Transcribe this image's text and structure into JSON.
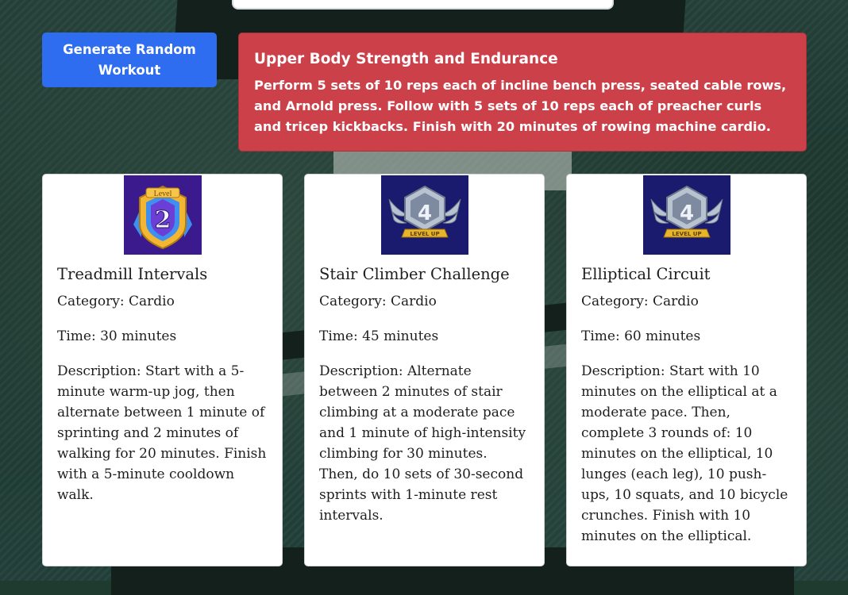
{
  "actions": {
    "generate_button_label": "Generate Random Workout"
  },
  "featured": {
    "title": "Upper Body Strength and Endurance",
    "description": "Perform 5 sets of 10 reps each of incline bench press, seated cable rows, and Arnold press. Follow with 5 sets of 10 reps each of preacher curls and tricep kickbacks. Finish with 20 minutes of rowing machine cardio."
  },
  "cards": [
    {
      "title": "Treadmill Intervals",
      "category": "Category: Cardio",
      "time": "Time: 30 minutes",
      "description": "Description: Start with a 5-minute warm-up jog, then alternate between 1 minute of sprinting and 2 minutes of walking for 20 minutes. Finish with a 5-minute cooldown walk.",
      "badge": {
        "icon": "level-badge-icon",
        "top_text": "Level",
        "number": "2",
        "colors": {
          "bg": "#3a1a8c",
          "gold": "#f2b632",
          "blue": "#3e8ff0"
        }
      }
    },
    {
      "title": "Stair Climber Challenge",
      "category": "Category: Cardio",
      "time": "Time: 45 minutes",
      "description": "Description: Alternate between 2 minutes of stair climbing at a moderate pace and 1 minute of high-intensity climbing for 30 minutes. Then, do 10 sets of 30-second sprints with 1-minute rest intervals.",
      "badge": {
        "icon": "level-up-badge-icon",
        "number": "4",
        "ribbon_text": "LEVEL UP",
        "colors": {
          "bg": "#1a1a6e",
          "silver": "#b8c2d0",
          "gold": "#e8b52a"
        }
      }
    },
    {
      "title": "Elliptical Circuit",
      "category": "Category: Cardio",
      "time": "Time: 60 minutes",
      "description": "Description: Start with 10 minutes on the elliptical at a moderate pace. Then, complete 3 rounds of: 10 minutes on the elliptical, 10 lunges (each leg), 10 push-ups, 10 squats, and 10 bicycle crunches. Finish with 10 minutes on the elliptical.",
      "badge": {
        "icon": "level-up-badge-icon",
        "number": "4",
        "ribbon_text": "LEVEL UP",
        "colors": {
          "bg": "#1a1a6e",
          "silver": "#b8c2d0",
          "gold": "#e8b52a"
        }
      }
    }
  ],
  "theme": {
    "primary": "#2f6df0",
    "danger": "#cc4149",
    "card_bg": "#ffffff"
  }
}
